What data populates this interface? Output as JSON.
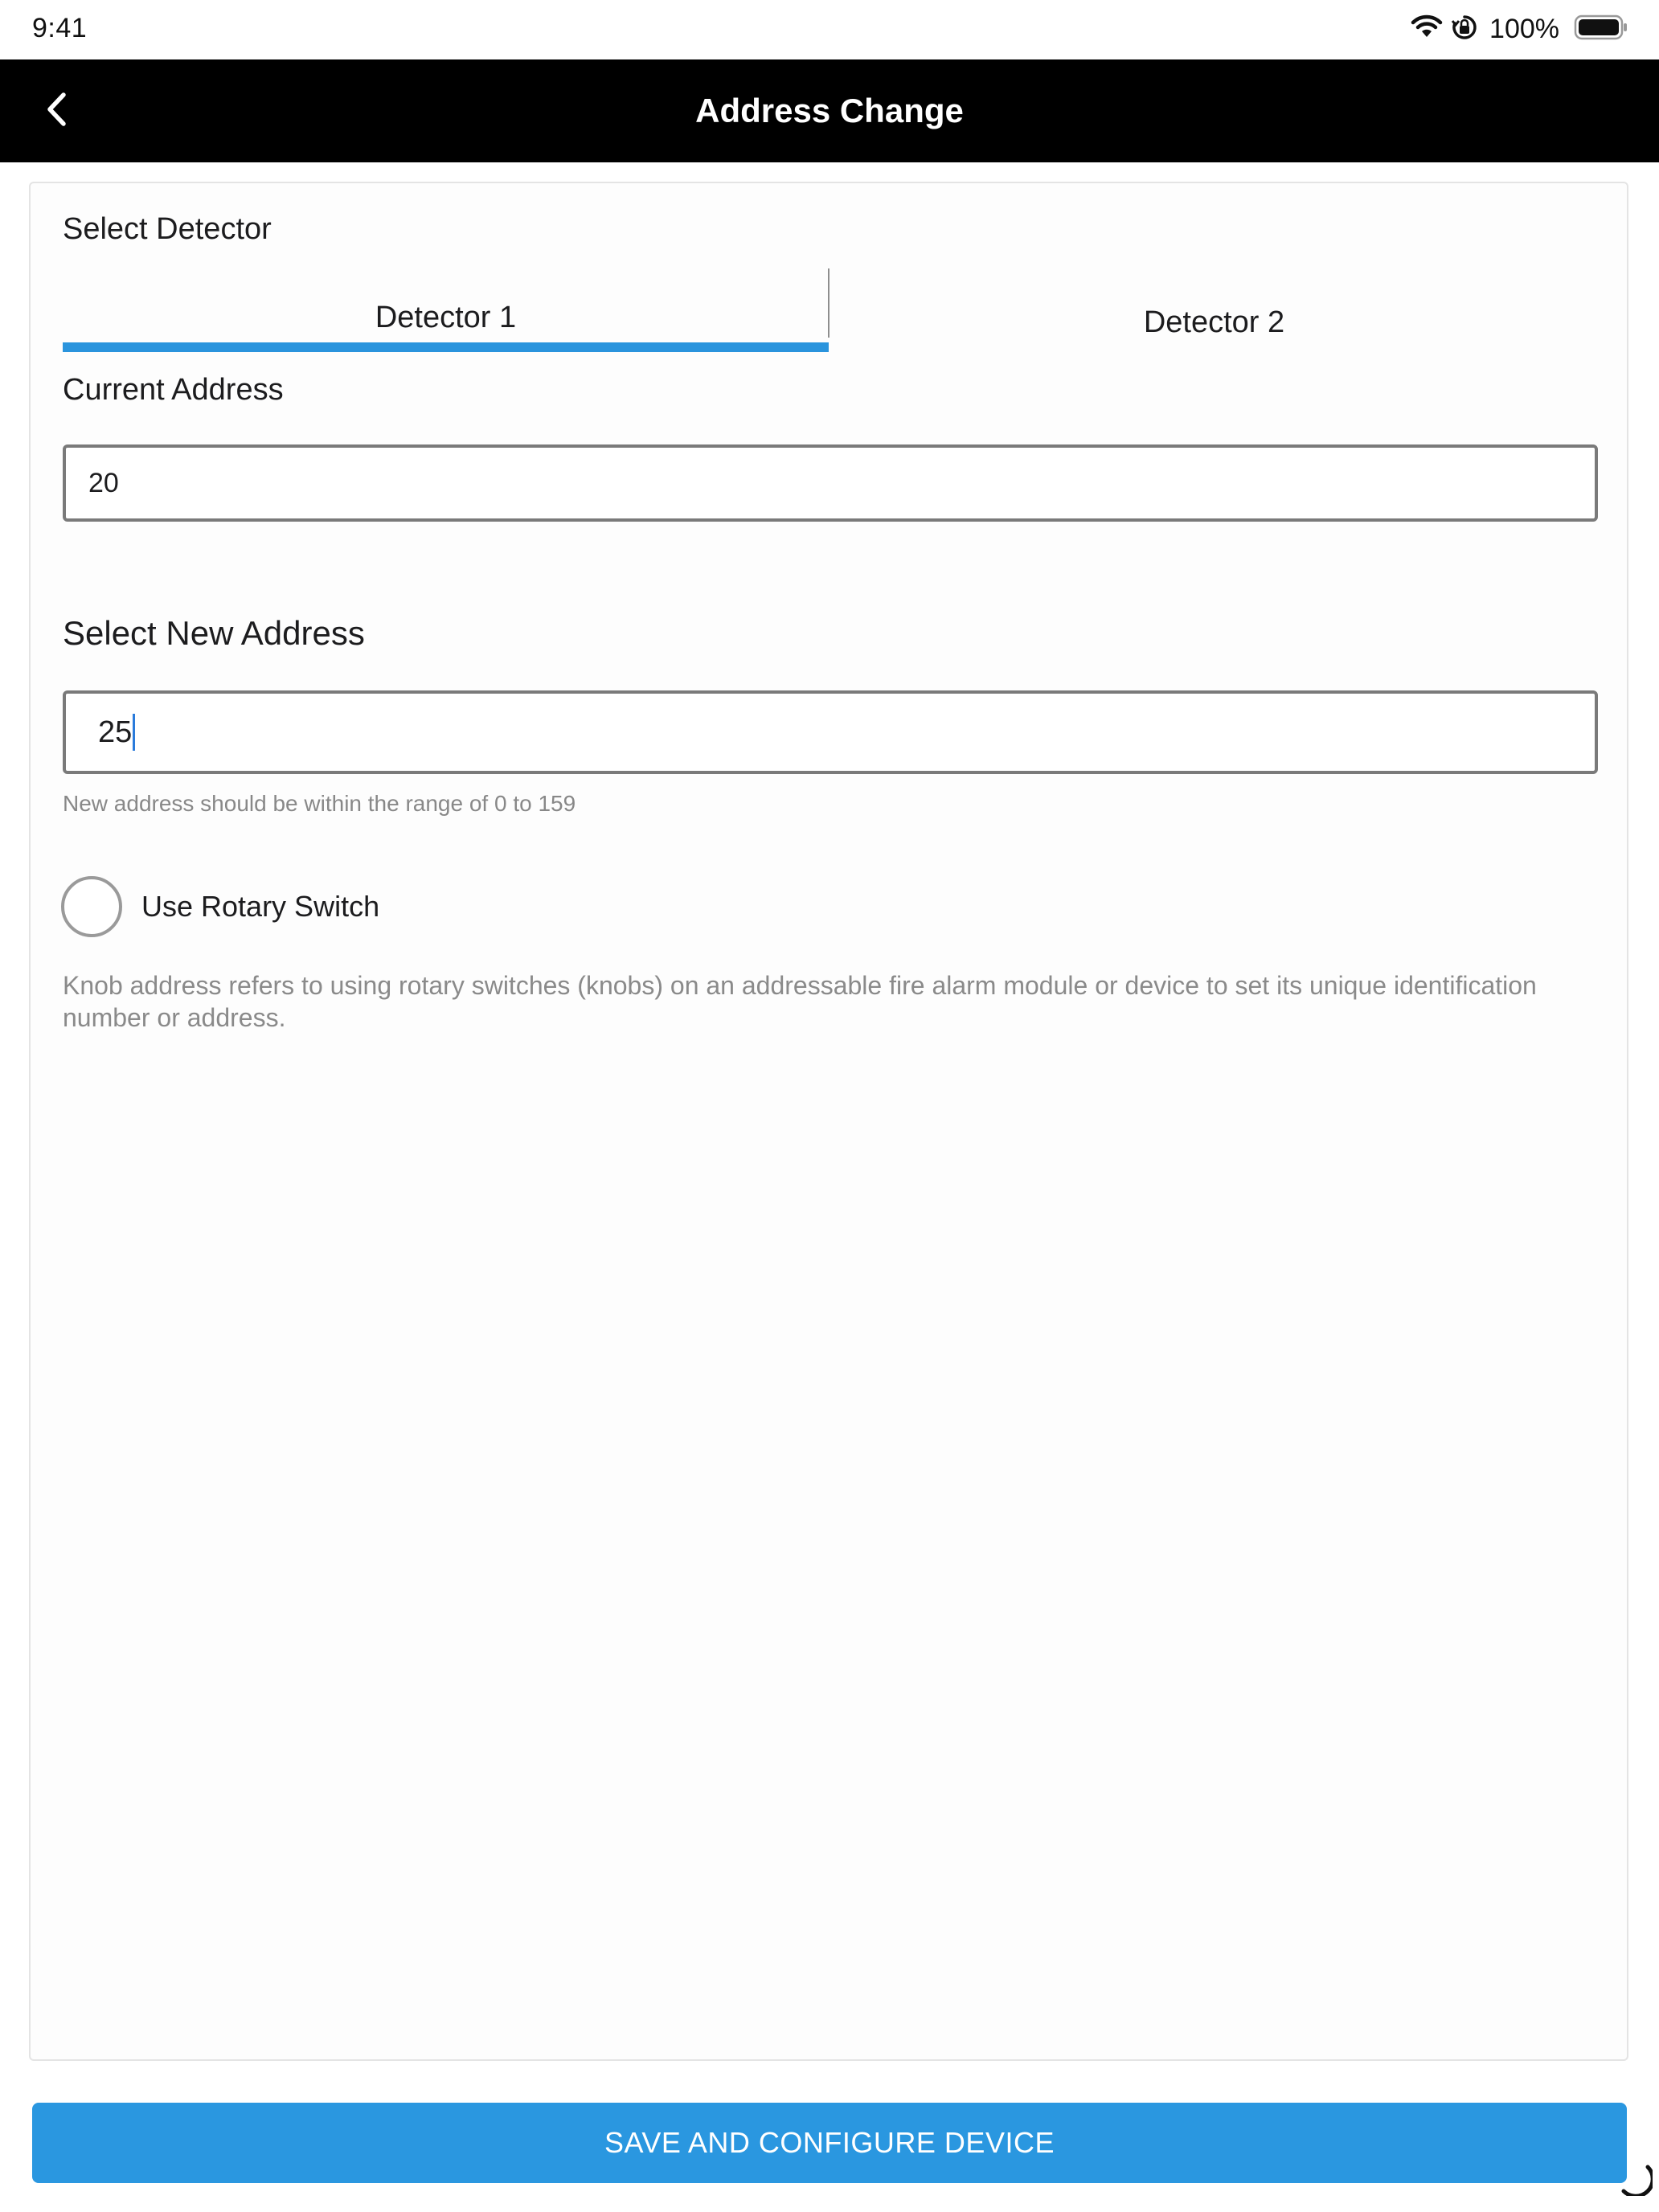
{
  "status_bar": {
    "time": "9:41",
    "battery_percent": "100%"
  },
  "nav": {
    "title": "Address Change",
    "back_icon": "chevron-left-icon"
  },
  "detector": {
    "label": "Select Detector",
    "tabs": [
      {
        "label": "Detector 1",
        "selected": true
      },
      {
        "label": "Detector 2",
        "selected": false
      }
    ]
  },
  "current_address": {
    "label": "Current Address",
    "value": "20"
  },
  "new_address": {
    "label": "Select New Address",
    "value": "25",
    "helper": "New address should be within the range of 0 to 159"
  },
  "rotary": {
    "label": "Use Rotary Switch",
    "checked": false,
    "description": "Knob address refers to using rotary switches (knobs) on an addressable fire alarm module or device to set its unique identification number or address."
  },
  "actions": {
    "save_label": "SAVE AND CONFIGURE DEVICE"
  },
  "colors": {
    "accent": "#2a97e0",
    "nav_background": "#000000"
  }
}
